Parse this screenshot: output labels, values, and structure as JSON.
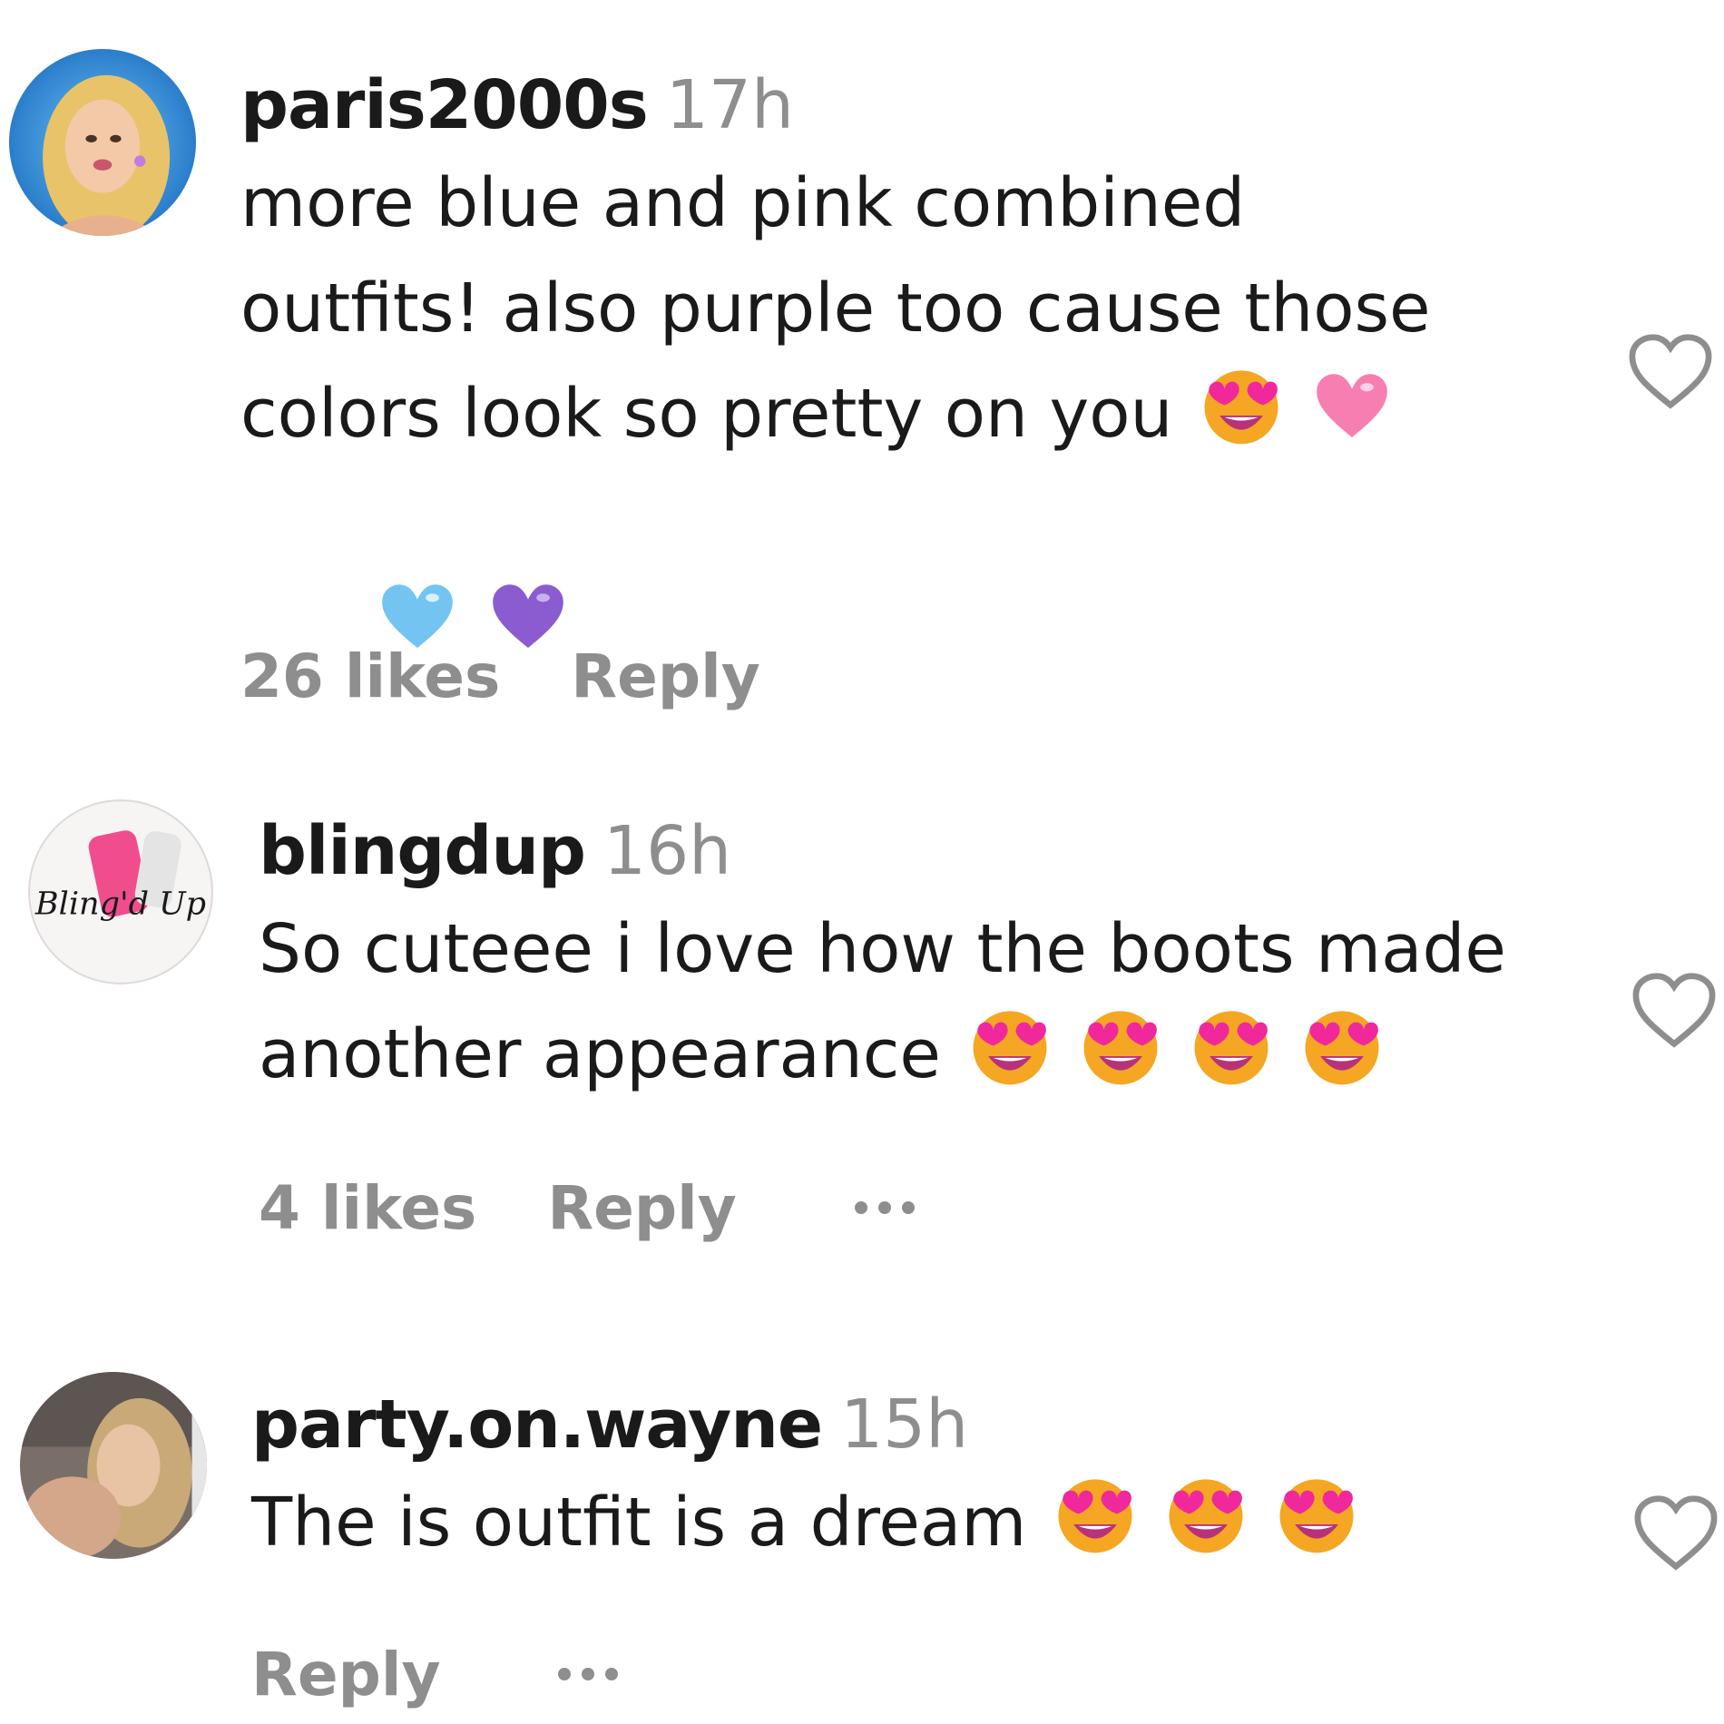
{
  "comments": [
    {
      "username": "paris2000s",
      "time": "17h",
      "text": "more blue and pink combined\noutfits! also purple too cause those\ncolors look so pretty on you",
      "text_emojis": [
        "heart-eyes-emoji",
        "pink-heart-emoji"
      ],
      "extra_emojis": [
        "light-blue-heart-emoji",
        "purple-heart-emoji"
      ],
      "likes": "26 likes",
      "reply": "Reply"
    },
    {
      "username": "blingdup",
      "time": "16h",
      "text": "So cuteee i love how the boots made\nanother appearance",
      "text_emojis": [
        "heart-eyes-emoji",
        "heart-eyes-emoji",
        "heart-eyes-emoji",
        "heart-eyes-emoji"
      ],
      "avatar_text": "Bling'd Up",
      "likes": "4 likes",
      "reply": "Reply"
    },
    {
      "username": "party.on.wayne",
      "time": "15h",
      "text": "The is outfit is a dream",
      "text_emojis": [
        "heart-eyes-emoji",
        "heart-eyes-emoji",
        "heart-eyes-emoji"
      ],
      "reply": "Reply"
    }
  ],
  "colors": {
    "secondary_text": "#8e8e8e",
    "primary_text": "#1a1a1a",
    "emoji_face": "#f5a623",
    "emoji_heart": "#f0289c"
  }
}
